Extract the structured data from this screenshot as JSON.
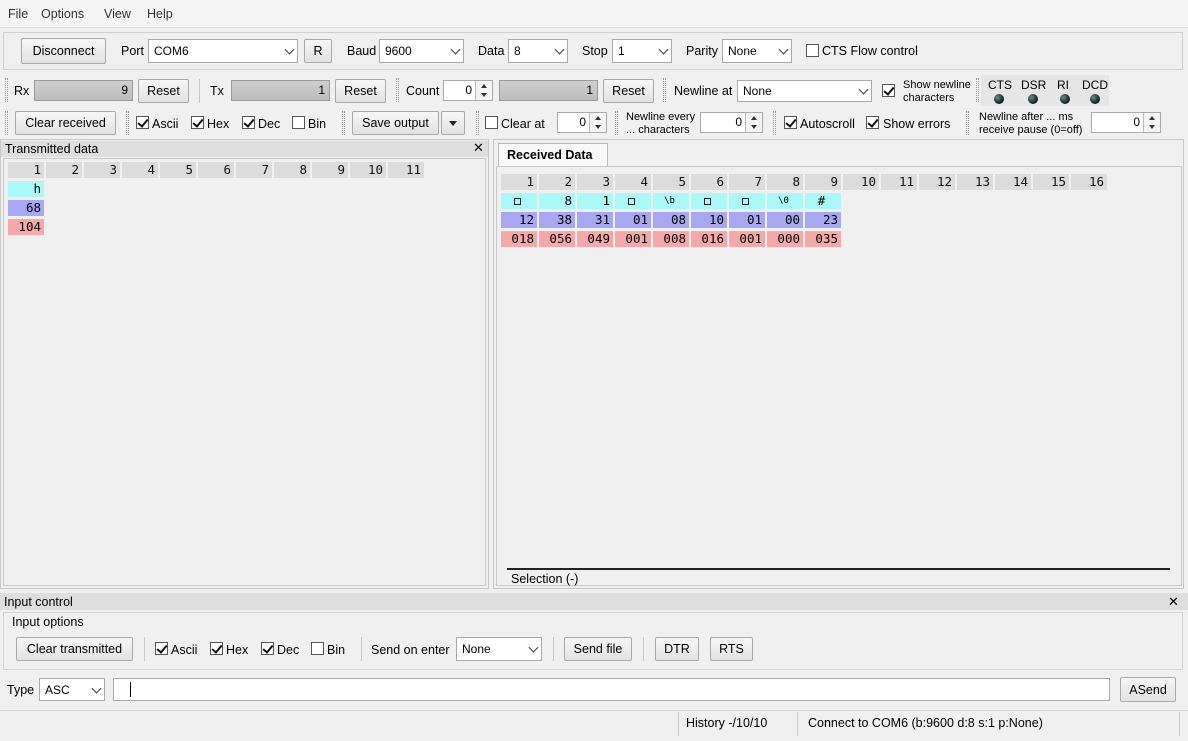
{
  "menu": {
    "items": [
      "File",
      "Options",
      "View",
      "Help"
    ]
  },
  "toolbar1": {
    "disconnect": "Disconnect",
    "port_label": "Port",
    "port_value": "COM6",
    "r_button": "R",
    "baud_label": "Baud",
    "baud_value": "9600",
    "data_label": "Data",
    "data_value": "8",
    "stop_label": "Stop",
    "stop_value": "1",
    "parity_label": "Parity",
    "parity_value": "None",
    "cts_flow": "CTS Flow control"
  },
  "toolbar2": {
    "rx_label": "Rx",
    "rx_count": "9",
    "reset": "Reset",
    "tx_label": "Tx",
    "tx_count": "1",
    "count_label": "Count",
    "count_value": "0",
    "count_bar": "1",
    "newline_at_label": "Newline at",
    "newline_at_value": "None",
    "show_newline_1": "Show newline",
    "show_newline_2": "characters",
    "signals": [
      "CTS",
      "DSR",
      "RI",
      "DCD"
    ]
  },
  "toolbar3": {
    "clear_received": "Clear received",
    "ascii": "Ascii",
    "hex": "Hex",
    "dec": "Dec",
    "bin": "Bin",
    "save_output": "Save output",
    "clear_at": "Clear at",
    "clear_at_value": "0",
    "newline_every_1": "Newline every",
    "newline_every_2": "... characters",
    "newline_every_value": "0",
    "autoscroll": "Autoscroll",
    "show_errors": "Show errors",
    "newline_after_1": "Newline after ... ms",
    "newline_after_2": "receive pause (0=off)",
    "newline_after_value": "0"
  },
  "transmitted": {
    "title": "Transmitted data",
    "columns": [
      "1",
      "2",
      "3",
      "4",
      "5",
      "6",
      "7",
      "8",
      "9",
      "10",
      "11"
    ],
    "ascii": [
      "h"
    ],
    "hex": [
      "68"
    ],
    "dec": [
      "104"
    ]
  },
  "received": {
    "tab": "Received Data",
    "columns": [
      "1",
      "2",
      "3",
      "4",
      "5",
      "6",
      "7",
      "8",
      "9",
      "10",
      "11",
      "12",
      "13",
      "14",
      "15",
      "16"
    ],
    "ascii": [
      "□",
      "8",
      "1",
      "□",
      "\\b",
      "□",
      "□",
      "\\0",
      "#"
    ],
    "hex": [
      "12",
      "38",
      "31",
      "01",
      "08",
      "10",
      "01",
      "00",
      "23"
    ],
    "dec": [
      "018",
      "056",
      "049",
      "001",
      "008",
      "016",
      "001",
      "000",
      "035"
    ],
    "selection": "Selection (-)"
  },
  "input_control": {
    "title": "Input control",
    "options_label": "Input options",
    "clear_transmitted": "Clear transmitted",
    "ascii": "Ascii",
    "hex": "Hex",
    "dec": "Dec",
    "bin": "Bin",
    "send_on_enter_label": "Send on enter",
    "send_on_enter_value": "None",
    "send_file": "Send file",
    "dtr": "DTR",
    "rts": "RTS",
    "type_label": "Type",
    "type_value": "ASC",
    "input_value": "",
    "asend": "ASend"
  },
  "status": {
    "history": "History -/10/10",
    "connection": "Connect to COM6 (b:9600 d:8 s:1 p:None)"
  }
}
